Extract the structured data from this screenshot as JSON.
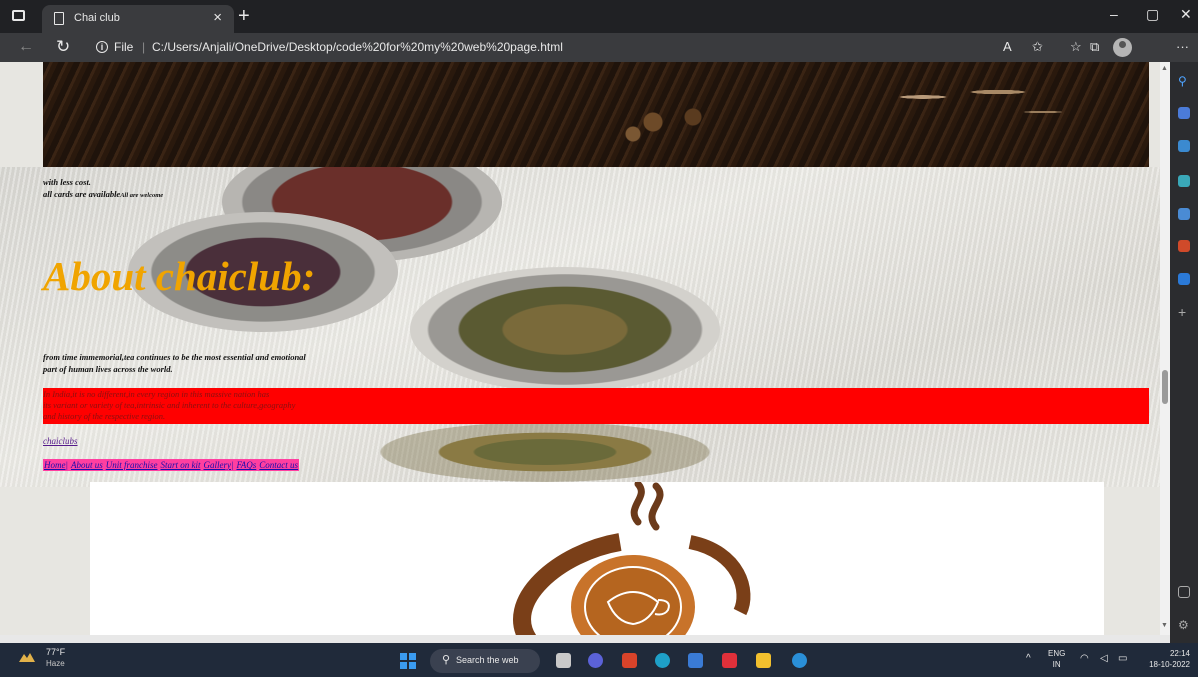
{
  "tab": {
    "title": "Chai club",
    "close": "×",
    "new": "+"
  },
  "window": {
    "minimize": "–",
    "restore": "▢",
    "close": "✕"
  },
  "address": {
    "file_label": "File",
    "url": "C:/Users/Anjali/OneDrive/Desktop/code%20for%20my%20web%20page.html",
    "back": "←",
    "refresh": "↻",
    "more": "···"
  },
  "toolbar_icons": [
    "read-aloud-icon",
    "favorites-add-icon",
    "favorites-icon",
    "collections-icon",
    "profile-icon"
  ],
  "page": {
    "intro_line1": "with less cost.",
    "intro_line2": "all cards are available",
    "intro_small": "All are welcome",
    "about_title": "About chaiclub:",
    "para1_line1": "from time immemorial,tea continues to be the most essential and emotional",
    "para1_line2": "part of human lives across the world.",
    "red_line1": "In India,it is no different,in every region in this massive nation has",
    "red_line2": "its variant or variety of tea,intrinsic and inherent to the culture,geography",
    "red_line3": "and history of the respective region.",
    "link": "chaiclubs",
    "menu": [
      "Home|",
      "About us",
      "Unit franchise",
      "Start on kit",
      "Gallery|",
      "FAQs",
      "Contact us"
    ],
    "colors": {
      "title": "#f0a400",
      "red_band": "#ff0000",
      "menu_bg": "#ff3fa0"
    }
  },
  "taskbar": {
    "weather_temp": "77°F",
    "weather_desc": "Haze",
    "search": "Search the web",
    "tray_up": "^",
    "lang1": "ENG",
    "lang2": "IN",
    "time": "22:14",
    "date": "18-10-2022"
  }
}
